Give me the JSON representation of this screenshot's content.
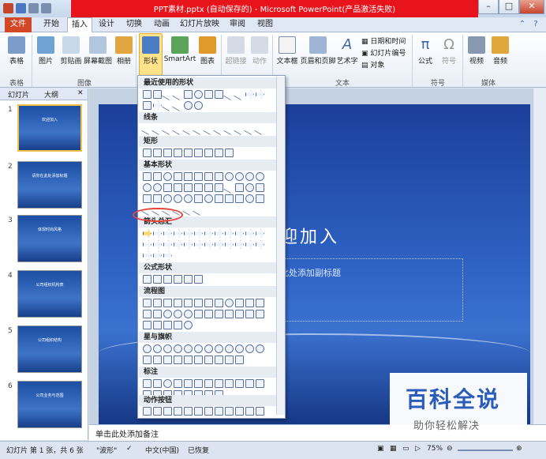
{
  "window": {
    "title": "PPT素材.pptx (自动保存的) - Microsoft PowerPoint(产品激活失败)"
  },
  "window_buttons": {
    "minimize": "–",
    "maximize": "□",
    "close": "✕"
  },
  "tabs": [
    "文件",
    "开始",
    "插入",
    "设计",
    "切换",
    "动画",
    "幻灯片放映",
    "审阅",
    "视图"
  ],
  "ribbon": {
    "buttons": {
      "table": "表格",
      "picture": "图片",
      "clipart": "剪贴画",
      "screenshot": "屏幕截图",
      "album": "相册",
      "shapes": "形状",
      "smartart": "SmartArt",
      "chart": "图表",
      "hyperlink": "超链接",
      "action": "动作",
      "textbox": "文本框",
      "header_footer": "页眉和页脚",
      "wordart": "艺术字",
      "datetime": "日期和时间",
      "slide_number": "幻灯片编号",
      "object": "对象",
      "equation": "公式",
      "symbol": "符号",
      "video": "视频",
      "audio": "音频"
    },
    "groups": {
      "tables": "表格",
      "images": "图像",
      "text": "文本",
      "symbols": "符号",
      "media": "媒体"
    }
  },
  "panel": {
    "tab_slides": "幻灯片",
    "tab_outline": "大纲",
    "close": "✕"
  },
  "thumbnails": [
    {
      "num": "1",
      "title": "欢迎加入"
    },
    {
      "num": "2",
      "title": "请你在此处添加标题"
    },
    {
      "num": "3",
      "title": "体现时尚风格"
    },
    {
      "num": "4",
      "title": "公司组织机构表"
    },
    {
      "num": "5",
      "title": "公司组织结构"
    },
    {
      "num": "6",
      "title": "公司业务与范围"
    }
  ],
  "shapes_menu": {
    "sections": [
      "最近使用的形状",
      "线条",
      "矩形",
      "基本形状",
      "箭头总汇",
      "公式形状",
      "流程图",
      "星与旗帜",
      "标注",
      "动作按钮"
    ]
  },
  "slide": {
    "title": "迎加入",
    "subtitle": "此处添加副标题"
  },
  "notes": {
    "placeholder": "单击此处添加备注"
  },
  "status": {
    "slide_info": "幻灯片 第 1 张，共 6 张",
    "theme": "\"波形\"",
    "language": "中文(中国)",
    "recovered": "已恢复",
    "zoom": "75%"
  },
  "watermark": {
    "line1": "百科全说",
    "line2": "助你轻松解决"
  }
}
